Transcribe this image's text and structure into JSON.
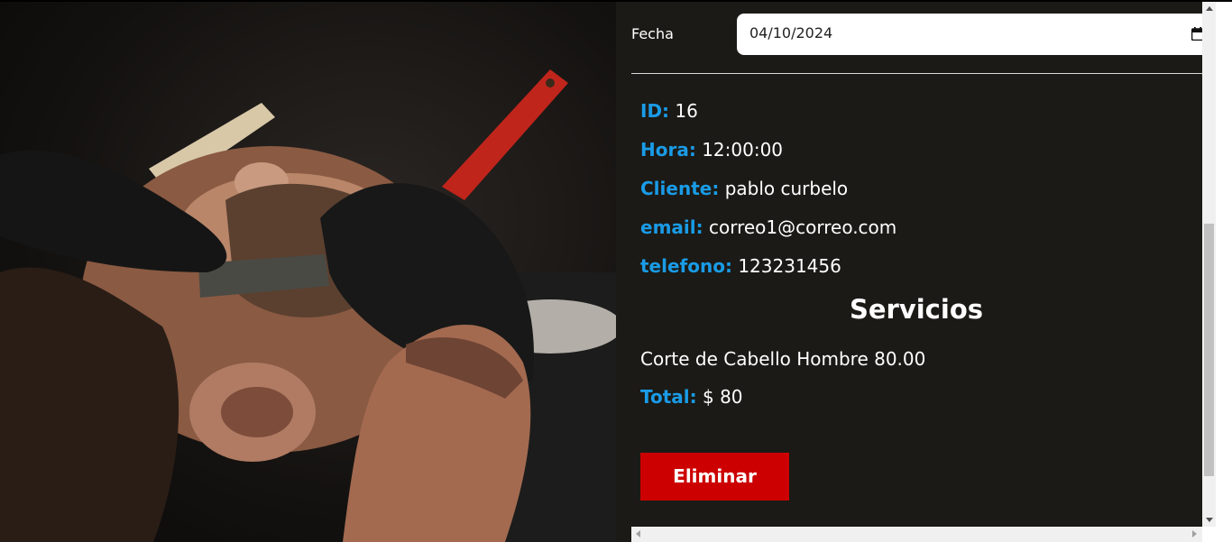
{
  "filter": {
    "date_label": "Fecha",
    "date_value": "04/10/2024"
  },
  "appointment": {
    "id_label": "ID:",
    "id_value": "16",
    "hora_label": "Hora:",
    "hora_value": "12:00:00",
    "cliente_label": "Cliente:",
    "cliente_value": "pablo curbelo",
    "email_label": "email:",
    "email_value": "correo1@correo.com",
    "telefono_label": "telefono:",
    "telefono_value": "123231456"
  },
  "services": {
    "heading": "Servicios",
    "items": [
      "Corte de Cabello Hombre 80.00"
    ]
  },
  "total": {
    "label": "Total:",
    "value": "$ 80"
  },
  "actions": {
    "delete_label": "Eliminar"
  },
  "colors": {
    "accent": "#1a9be6",
    "danger": "#cc0000",
    "panel_bg": "#1b1a16"
  },
  "icons": {
    "calendar": "calendar-icon"
  }
}
